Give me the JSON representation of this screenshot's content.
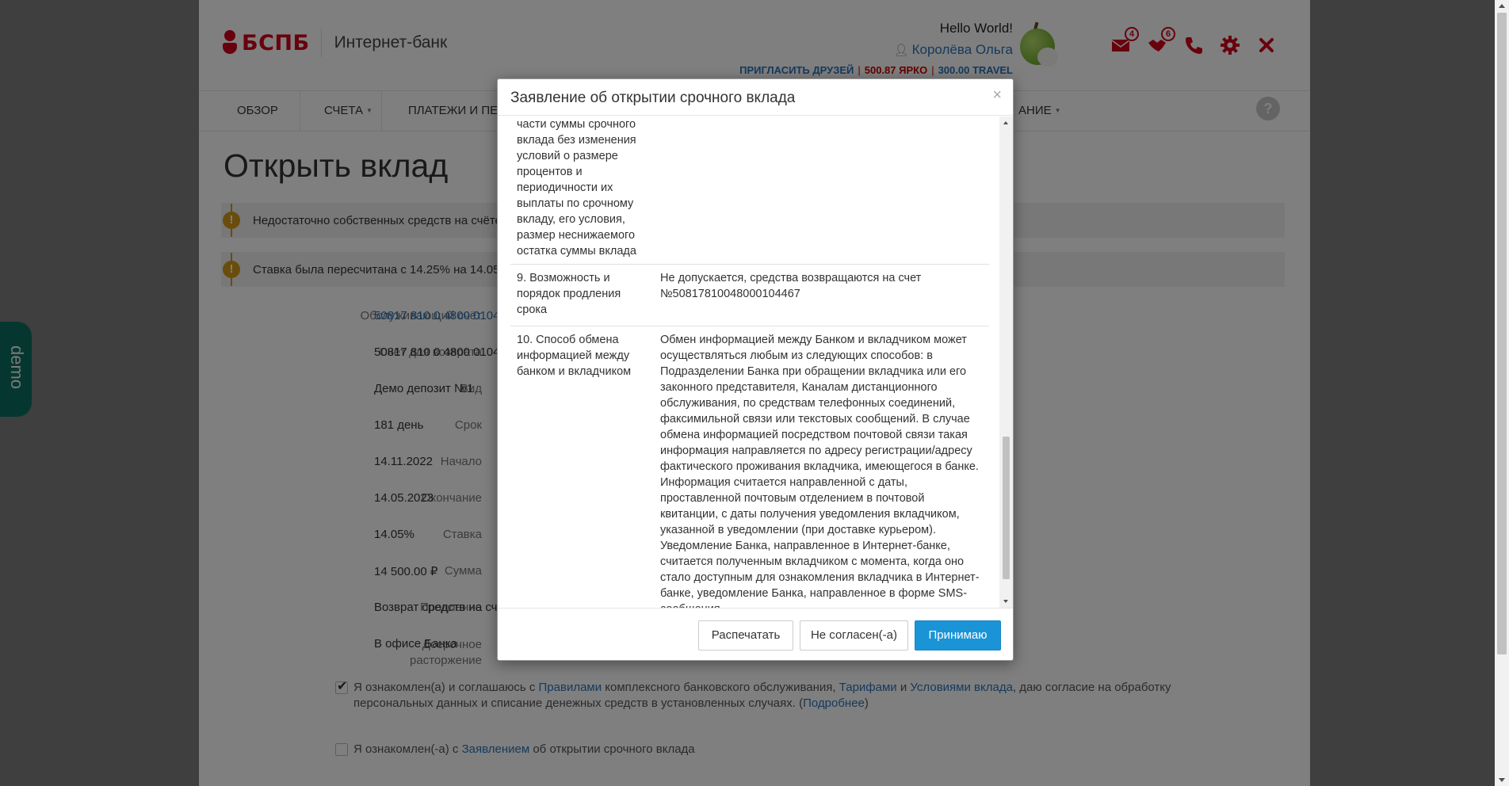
{
  "header": {
    "logo_text": "БСПБ",
    "logo_subtitle": "Интернет-банк",
    "hello": "Hello World!",
    "user_name": "Королёва Ольга",
    "invite": "ПРИГЛАСИТЬ ДРУЗЕЙ",
    "sep": "|",
    "yarko": "500.87 ЯРКО",
    "travel": "300.00 TRAVEL",
    "messages_count": "4",
    "offers_count": "6",
    "icons": [
      "envelope-icon",
      "handshake-icon",
      "phone-icon",
      "gear-icon",
      "close-icon"
    ],
    "accent_color": "#d0021b"
  },
  "nav": {
    "items": [
      "ОБЗОР",
      "СЧЕТА",
      "ПЛАТЕЖИ И ПЕР",
      "АНИЕ"
    ],
    "help": "?"
  },
  "page": {
    "title": "Открыть вклад",
    "alerts": [
      "Недостаточно собственных средств на счёте,",
      "Ставка была пересчитана с 14.25% на 14.05%"
    ],
    "fields": [
      {
        "label": "Обслуживающий счёт",
        "value": "50817 810 0 4800 01044"
      },
      {
        "label": "Счёт для возврата",
        "value": "50817 810 0 4800 01044"
      },
      {
        "label": "Вид",
        "value": "Демо депозит №1"
      },
      {
        "label": "Срок",
        "value": "181 день"
      },
      {
        "label": "Начало",
        "value": "14.11.2022"
      },
      {
        "label": "Окончание",
        "value": "14.05.2023"
      },
      {
        "label": "Ставка",
        "value": "14.05%"
      },
      {
        "label": "Сумма",
        "value": "14 500.00 ₽"
      },
      {
        "label": "Продление",
        "value": "Возврат средств на счё"
      },
      {
        "label_1": "Досрочное",
        "label_2": "расторжение",
        "value": "В офисе Банка"
      }
    ],
    "agree1": {
      "t1": "Я ознакомлен(а) и соглашаюсь с ",
      "l1": "Правилами",
      "t2": " комплексного банковского обслуживания, ",
      "l2": "Тарифами",
      "t3": " и ",
      "l3": "Условиями вклада",
      "t4": ", даю согласие на обработку персональных данных и списание денежных средств в установленных случаях. (",
      "l4": "Подробнее",
      "t5": ")",
      "checked": true
    },
    "agree2": {
      "t1": "Я ознакомлен(-а) с ",
      "l1": "Заявлением",
      "t2": " об открытии срочного вклада",
      "checked": false
    },
    "demo_tab": "demo"
  },
  "modal": {
    "title": "Заявление об открытии срочного вклада",
    "close": "×",
    "rows": [
      {
        "name": "части суммы срочного вклада без изменения условий о размере процентов и периодичности их выплаты по срочному вкладу, его условия, размер неснижаемого остатка суммы вклада",
        "value": ""
      },
      {
        "name": "9. Возможность и порядок продления срока",
        "value": "Не допускается, средства возвращаются на счет №50817810048000104467"
      },
      {
        "name": "10. Способ обмена информацией между банком и вкладчиком",
        "value": "Обмен информацией между Банком и вкладчиком может осуществляться любым из следующих способов: в Подразделении Банка при обращении вкладчика или его законного представителя, Каналам дистанционного обслуживания, по средствам телефонных соединений, факсимильной связи или текстовых сообщений. В случае обмена информацией посредством почтовой связи такая информация направляется по адресу регистрации/адресу фактического проживания вкладчика, имеющегося в банке. Информация считается направленной с даты, проставленной почтовым отделением в почтовой квитанции, с даты получения уведомления вкладчиком, указанной в уведомлении (при доставке курьером). Уведомление Банка, направленное в Интернет-банке, считается полученным вкладчиком с момента, когда оно стало доступным для ознакомления вкладчика в Интернет-банке, уведомление Банка, направленное в форме SMS-сообщения"
      }
    ],
    "buttons": {
      "print": "Распечатать",
      "decline": "Не согласен(-а)",
      "accept": "Принимаю"
    }
  }
}
